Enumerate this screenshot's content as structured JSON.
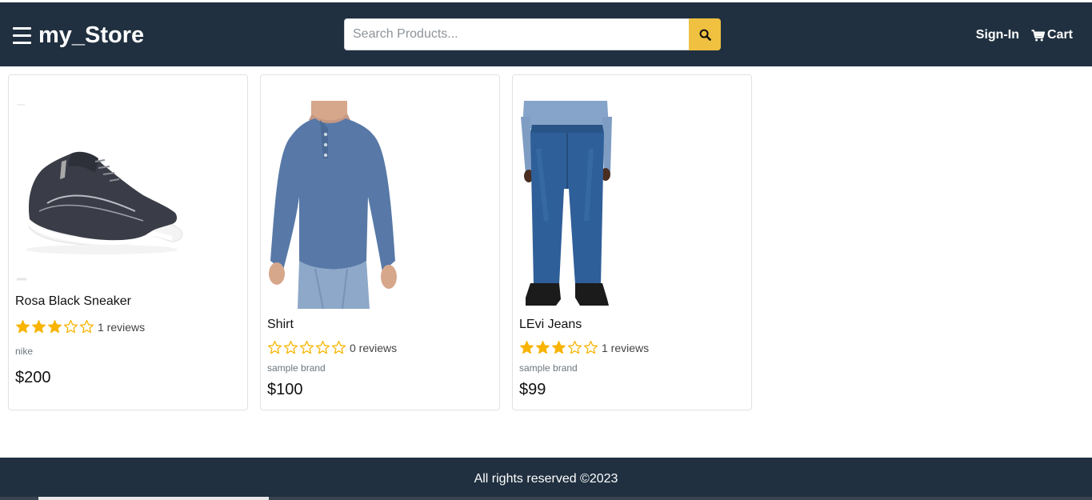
{
  "header": {
    "brand": "my_Store",
    "search_placeholder": "Search Products...",
    "signin": "Sign-In",
    "cart": "Cart"
  },
  "products": [
    {
      "name": "Rosa Black Sneaker",
      "rating": 3,
      "reviews": "1 reviews",
      "brand": "nike",
      "price": "$200"
    },
    {
      "name": "Shirt",
      "rating": 0,
      "reviews": "0 reviews",
      "brand": "sample brand",
      "price": "$100"
    },
    {
      "name": "LEvi Jeans",
      "rating": 3,
      "reviews": "1 reviews",
      "brand": "sample brand",
      "price": "$99"
    }
  ],
  "footer": {
    "text": "All rights reserved ©2023"
  },
  "colors": {
    "navbar": "#203040",
    "accent": "#f0c040",
    "star": "#f8b400"
  },
  "icons": {
    "menu": "hamburger-icon",
    "search": "search-icon",
    "cart": "cart-icon",
    "star_full": "star-filled-icon",
    "star_empty": "star-empty-icon"
  }
}
